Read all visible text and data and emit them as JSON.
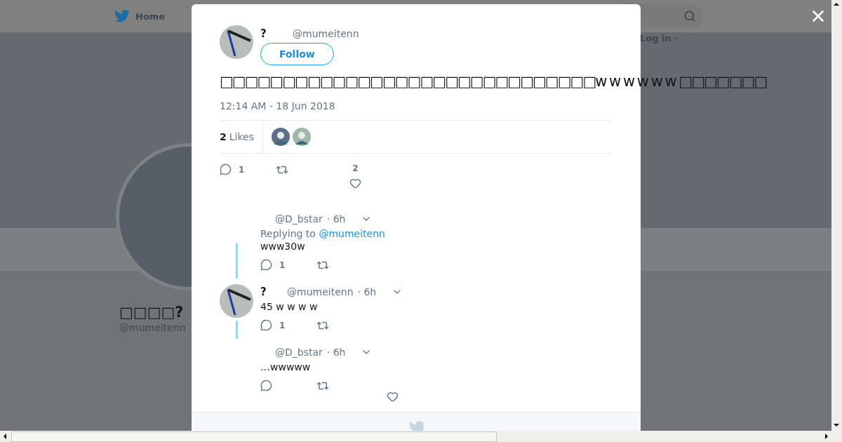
{
  "nav": {
    "home": "Home",
    "login": "Log in"
  },
  "profile": {
    "name": "□□□□?",
    "handle": "@mumeitenn"
  },
  "tweet": {
    "name": "?",
    "handle": "@mumeitenn",
    "follow": "Follow",
    "text": "□□□□□□□□□□□□□□□□□□□□□□□□□□□□□□w w w w w w □□□□□□□",
    "time": "12:14 AM - 18 Jun 2018",
    "likes_count": "2",
    "likes_label": "Likes",
    "reply_count": "1",
    "like_count": "2"
  },
  "replies": [
    {
      "avatar": false,
      "handle": "@D_bstar",
      "time": "· 6h",
      "replying_label": "Replying to",
      "replying_handle": "@mumeitenn",
      "text": "www30w",
      "reply_count": "1",
      "thread_line": true
    },
    {
      "avatar": true,
      "name": "?",
      "handle": "@mumeitenn",
      "time": "· 6h",
      "text": "45 w w w w",
      "reply_count": "1",
      "thread_line": true
    },
    {
      "avatar": false,
      "handle": "@D_bstar",
      "time": "· 6h",
      "text": "…wwwww",
      "thread_line": false
    }
  ]
}
